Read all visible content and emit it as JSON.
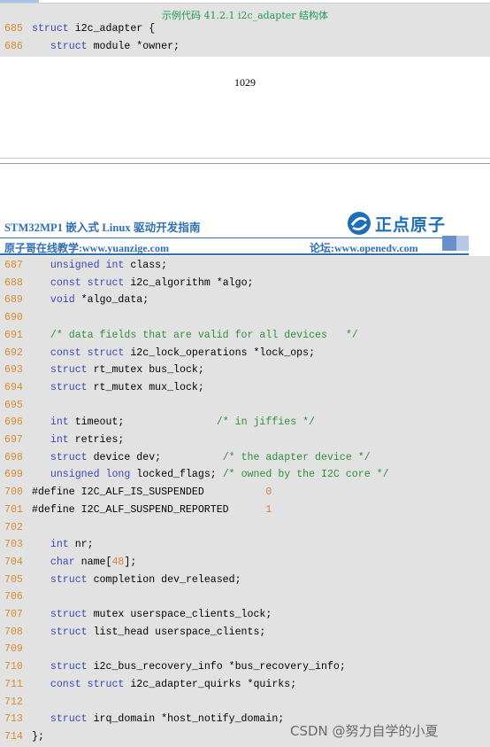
{
  "caption": "示例代码 41.2.1 i2c_adapter 结构体",
  "page_number": "1029",
  "header": {
    "title": "STM32MP1 嵌入式 Linux 驱动开发指南",
    "subtitle_left": "原子哥在线教学:www.yuanzige.com",
    "subtitle_right": "论坛:www.openedv.com",
    "logo_text": "正点原子"
  },
  "watermark": "CSDN @努力自学的小夏",
  "colors": {
    "line_number": "#d98b2f",
    "keyword": "#3d49b8",
    "comment": "#2f8f3d",
    "number": "#e0803a",
    "code_background": "#e2e2e2",
    "brand_blue": "#2f6fb3",
    "caption_green": "#1f9a55"
  },
  "code_block_1": [
    {
      "no": "685",
      "parts": [
        {
          "t": "kw",
          "text": "struct"
        },
        {
          "t": "plain",
          "text": " i2c_adapter {"
        }
      ]
    },
    {
      "no": "686",
      "parts": [
        {
          "t": "plain",
          "text": "   "
        },
        {
          "t": "kw",
          "text": "struct"
        },
        {
          "t": "plain",
          "text": " module *owner;"
        }
      ]
    }
  ],
  "code_block_2": [
    {
      "no": "687",
      "parts": [
        {
          "t": "plain",
          "text": "   "
        },
        {
          "t": "kw",
          "text": "unsigned int"
        },
        {
          "t": "plain",
          "text": " class;"
        }
      ]
    },
    {
      "no": "688",
      "parts": [
        {
          "t": "plain",
          "text": "   "
        },
        {
          "t": "kw",
          "text": "const struct"
        },
        {
          "t": "plain",
          "text": " i2c_algorithm *algo;"
        }
      ]
    },
    {
      "no": "689",
      "parts": [
        {
          "t": "plain",
          "text": "   "
        },
        {
          "t": "kw",
          "text": "void"
        },
        {
          "t": "plain",
          "text": " *algo_data;"
        }
      ]
    },
    {
      "no": "690",
      "parts": []
    },
    {
      "no": "691",
      "parts": [
        {
          "t": "plain",
          "text": "   "
        },
        {
          "t": "cm",
          "text": "/* data fields that are valid for all devices   */"
        }
      ]
    },
    {
      "no": "692",
      "parts": [
        {
          "t": "plain",
          "text": "   "
        },
        {
          "t": "kw",
          "text": "const struct"
        },
        {
          "t": "plain",
          "text": " i2c_lock_operations *lock_ops;"
        }
      ]
    },
    {
      "no": "693",
      "parts": [
        {
          "t": "plain",
          "text": "   "
        },
        {
          "t": "kw",
          "text": "struct"
        },
        {
          "t": "plain",
          "text": " rt_mutex bus_lock;"
        }
      ]
    },
    {
      "no": "694",
      "parts": [
        {
          "t": "plain",
          "text": "   "
        },
        {
          "t": "kw",
          "text": "struct"
        },
        {
          "t": "plain",
          "text": " rt_mutex mux_lock;"
        }
      ]
    },
    {
      "no": "695",
      "parts": []
    },
    {
      "no": "696",
      "parts": [
        {
          "t": "plain",
          "text": "   "
        },
        {
          "t": "kw",
          "text": "int"
        },
        {
          "t": "plain",
          "text": " timeout;               "
        },
        {
          "t": "cm",
          "text": "/* in jiffies */"
        }
      ]
    },
    {
      "no": "697",
      "parts": [
        {
          "t": "plain",
          "text": "   "
        },
        {
          "t": "kw",
          "text": "int"
        },
        {
          "t": "plain",
          "text": " retries;"
        }
      ]
    },
    {
      "no": "698",
      "parts": [
        {
          "t": "plain",
          "text": "   "
        },
        {
          "t": "kw",
          "text": "struct"
        },
        {
          "t": "plain",
          "text": " device dev;          "
        },
        {
          "t": "cm",
          "text": "/* the adapter device */"
        }
      ]
    },
    {
      "no": "699",
      "parts": [
        {
          "t": "plain",
          "text": "   "
        },
        {
          "t": "kw",
          "text": "unsigned long"
        },
        {
          "t": "plain",
          "text": " locked_flags; "
        },
        {
          "t": "cm",
          "text": "/* owned by the I2C core */"
        }
      ]
    },
    {
      "no": "700",
      "parts": [
        {
          "t": "plain",
          "text": "#define I2C_ALF_IS_SUSPENDED          "
        },
        {
          "t": "num",
          "text": "0"
        }
      ]
    },
    {
      "no": "701",
      "parts": [
        {
          "t": "plain",
          "text": "#define I2C_ALF_SUSPEND_REPORTED      "
        },
        {
          "t": "num",
          "text": "1"
        }
      ]
    },
    {
      "no": "702",
      "parts": []
    },
    {
      "no": "703",
      "parts": [
        {
          "t": "plain",
          "text": "   "
        },
        {
          "t": "kw",
          "text": "int"
        },
        {
          "t": "plain",
          "text": " nr;"
        }
      ]
    },
    {
      "no": "704",
      "parts": [
        {
          "t": "plain",
          "text": "   "
        },
        {
          "t": "kw",
          "text": "char"
        },
        {
          "t": "plain",
          "text": " name["
        },
        {
          "t": "num",
          "text": "48"
        },
        {
          "t": "plain",
          "text": "];"
        }
      ]
    },
    {
      "no": "705",
      "parts": [
        {
          "t": "plain",
          "text": "   "
        },
        {
          "t": "kw",
          "text": "struct"
        },
        {
          "t": "plain",
          "text": " completion dev_released;"
        }
      ]
    },
    {
      "no": "706",
      "parts": []
    },
    {
      "no": "707",
      "parts": [
        {
          "t": "plain",
          "text": "   "
        },
        {
          "t": "kw",
          "text": "struct"
        },
        {
          "t": "plain",
          "text": " mutex userspace_clients_lock;"
        }
      ]
    },
    {
      "no": "708",
      "parts": [
        {
          "t": "plain",
          "text": "   "
        },
        {
          "t": "kw",
          "text": "struct"
        },
        {
          "t": "plain",
          "text": " list_head userspace_clients;"
        }
      ]
    },
    {
      "no": "709",
      "parts": []
    },
    {
      "no": "710",
      "parts": [
        {
          "t": "plain",
          "text": "   "
        },
        {
          "t": "kw",
          "text": "struct"
        },
        {
          "t": "plain",
          "text": " i2c_bus_recovery_info *bus_recovery_info;"
        }
      ]
    },
    {
      "no": "711",
      "parts": [
        {
          "t": "plain",
          "text": "   "
        },
        {
          "t": "kw",
          "text": "const struct"
        },
        {
          "t": "plain",
          "text": " i2c_adapter_quirks *quirks;"
        }
      ]
    },
    {
      "no": "712",
      "parts": []
    },
    {
      "no": "713",
      "parts": [
        {
          "t": "plain",
          "text": "   "
        },
        {
          "t": "kw",
          "text": "struct"
        },
        {
          "t": "plain",
          "text": " irq_domain *host_notify_domain;"
        }
      ]
    },
    {
      "no": "714",
      "parts": [
        {
          "t": "plain",
          "text": "};"
        }
      ]
    }
  ]
}
